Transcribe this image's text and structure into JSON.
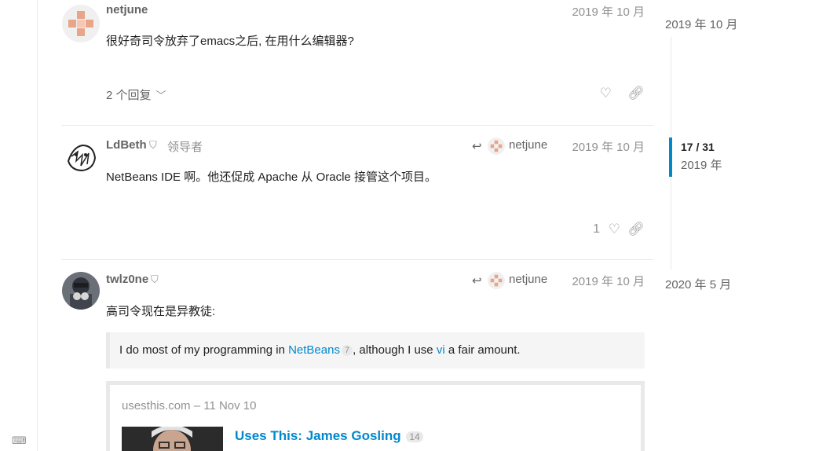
{
  "posts": [
    {
      "username": "netjune",
      "date": "2019 年 10 月",
      "text": "很好奇司令放弃了emacs之后, 在用什么编辑器?",
      "replies_label": "2 个回复",
      "avatar": "netjune-avatar",
      "accent": "#e8a587"
    },
    {
      "username": "LdBeth",
      "title": "领导者",
      "reply_to": "netjune",
      "date": "2019 年 10 月",
      "text": "NetBeans IDE 啊。他还促成 Apache 从 Oracle 接管这个项目。",
      "like_count": "1"
    },
    {
      "username": "twlz0ne",
      "reply_to": "netjune",
      "date": "2019 年 10 月",
      "text": "高司令现在是异教徒:",
      "quote": {
        "before": "I do most of my programming in ",
        "link1": "NetBeans",
        "link1_count": "7",
        "middle": ", although I use ",
        "link2": "vi",
        "after": " a fair amount."
      },
      "onebox": {
        "source": "usesthis.com – 11 Nov 10",
        "title": "Uses This: James Gosling",
        "click_count": "14"
      }
    }
  ],
  "timeline": {
    "top_date": "2019 年 10 月",
    "position": "17 / 31",
    "position_date": "2019 年",
    "bottom_date": "2020 年 5 月",
    "accent": "#0088cc"
  },
  "icons": {
    "shield": "shield-icon",
    "heart": "heart-icon",
    "link": "link-icon",
    "reply": "reply-arrow-icon",
    "chevron": "chevron-down-icon",
    "keyboard": "keyboard-icon"
  }
}
